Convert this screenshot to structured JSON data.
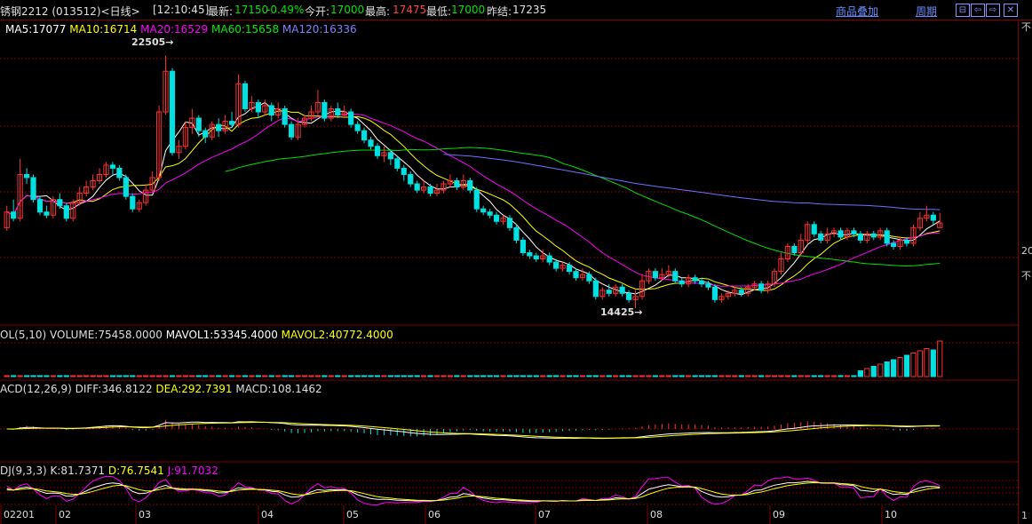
{
  "header": {
    "instrument": "锈钢2212 (013512)<日线>",
    "time": "[12:10:45]",
    "last_label": "最新:",
    "last_value": "17150",
    "change": "-0.49%",
    "open_label": "今开:",
    "open_value": "17000",
    "high_label": "最高:",
    "high_value": "17475",
    "low_label": "最低:",
    "low_value": "17000",
    "prev_label": "昨结:",
    "prev_value": "17235",
    "overlay_link": "商品叠加",
    "period_link": "周期"
  },
  "toolbar_icons": [
    "restore-icon",
    "back-icon",
    "forward-icon",
    "close-icon"
  ],
  "colors": {
    "up": "#ff3030",
    "down": "#00e0e0",
    "ma5": "#ffffff",
    "ma10": "#ffff00",
    "ma20": "#ff00ff",
    "ma60": "#00e000",
    "ma120": "#7070ff",
    "grid": "#800000"
  },
  "ma_legend": {
    "ma5": "MA5:17077",
    "ma10": "MA10:16714",
    "ma20": "MA20:16529",
    "ma60": "MA60:15658",
    "ma120": "MA120:16336"
  },
  "vol_legend": {
    "name": "OL(5,10)",
    "volume": "VOLUME:75458.0000",
    "mavol1": "MAVOL1:53345.4000",
    "mavol2": "MAVOL2:40772.4000"
  },
  "macd_legend": {
    "name": "ACD(12,26,9)",
    "diff": "DIFF:346.8122",
    "dea": "DEA:292.7391",
    "macd": "MACD:108.1462"
  },
  "kdj_legend": {
    "name": "DJ(9,3,3)",
    "k": "K:81.7371",
    "d": "D:76.7541",
    "j": "J:91.7032"
  },
  "right_panel": {
    "t1": "不",
    "t2": "20",
    "t3": "不",
    "t4": "1"
  },
  "chart_data": {
    "type": "candlestick",
    "price_annotations": {
      "high": "22505→",
      "low": "14425→"
    },
    "x_tick_labels": [
      "02201",
      "02",
      "03",
      "04",
      "05",
      "06",
      "07",
      "08",
      "09",
      "10"
    ],
    "price_range": [
      14000,
      23000
    ],
    "candles": [
      {
        "o": 17000,
        "c": 17500,
        "h": 17700,
        "l": 16900
      },
      {
        "o": 17500,
        "c": 17300,
        "h": 17900,
        "l": 17200
      },
      {
        "o": 17300,
        "c": 18700,
        "h": 19200,
        "l": 17200
      },
      {
        "o": 18700,
        "c": 18600,
        "h": 18900,
        "l": 18400
      },
      {
        "o": 18600,
        "c": 17900,
        "h": 18700,
        "l": 17800
      },
      {
        "o": 17900,
        "c": 17500,
        "h": 18000,
        "l": 17400
      },
      {
        "o": 17500,
        "c": 17400,
        "h": 17700,
        "l": 17300
      },
      {
        "o": 17400,
        "c": 17900,
        "h": 18000,
        "l": 17300
      },
      {
        "o": 17900,
        "c": 17700,
        "h": 18100,
        "l": 17600
      },
      {
        "o": 17700,
        "c": 17300,
        "h": 17800,
        "l": 17200
      },
      {
        "o": 17300,
        "c": 17800,
        "h": 17900,
        "l": 17200
      },
      {
        "o": 17800,
        "c": 18100,
        "h": 18300,
        "l": 17700
      },
      {
        "o": 18100,
        "c": 18300,
        "h": 18500,
        "l": 18000
      },
      {
        "o": 18300,
        "c": 18500,
        "h": 18700,
        "l": 18200
      },
      {
        "o": 18500,
        "c": 18700,
        "h": 18900,
        "l": 18400
      },
      {
        "o": 18700,
        "c": 19000,
        "h": 19100,
        "l": 18600
      },
      {
        "o": 19000,
        "c": 18900,
        "h": 19100,
        "l": 18700
      },
      {
        "o": 18900,
        "c": 18600,
        "h": 19000,
        "l": 18500
      },
      {
        "o": 18600,
        "c": 18000,
        "h": 18700,
        "l": 17900
      },
      {
        "o": 18000,
        "c": 17600,
        "h": 18100,
        "l": 17500
      },
      {
        "o": 17600,
        "c": 17800,
        "h": 17900,
        "l": 17500
      },
      {
        "o": 17800,
        "c": 18200,
        "h": 18400,
        "l": 17700
      },
      {
        "o": 18200,
        "c": 18600,
        "h": 18800,
        "l": 18100
      },
      {
        "o": 18600,
        "c": 20700,
        "h": 20900,
        "l": 18500
      },
      {
        "o": 20700,
        "c": 22000,
        "h": 22505,
        "l": 20600
      },
      {
        "o": 22000,
        "c": 19400,
        "h": 22100,
        "l": 19300
      },
      {
        "o": 19400,
        "c": 19600,
        "h": 19800,
        "l": 19200
      },
      {
        "o": 19600,
        "c": 20200,
        "h": 20400,
        "l": 19500
      },
      {
        "o": 20200,
        "c": 20500,
        "h": 20800,
        "l": 20000
      },
      {
        "o": 20500,
        "c": 20100,
        "h": 20600,
        "l": 19900
      },
      {
        "o": 20100,
        "c": 19900,
        "h": 20200,
        "l": 19700
      },
      {
        "o": 19900,
        "c": 20300,
        "h": 20400,
        "l": 19800
      },
      {
        "o": 20300,
        "c": 20100,
        "h": 20500,
        "l": 19900
      },
      {
        "o": 20100,
        "c": 20400,
        "h": 20600,
        "l": 20000
      },
      {
        "o": 20400,
        "c": 20300,
        "h": 20700,
        "l": 20200
      },
      {
        "o": 20300,
        "c": 21600,
        "h": 21900,
        "l": 20200
      },
      {
        "o": 21600,
        "c": 20800,
        "h": 21700,
        "l": 20700
      },
      {
        "o": 20800,
        "c": 21000,
        "h": 21200,
        "l": 20700
      },
      {
        "o": 21000,
        "c": 20700,
        "h": 21100,
        "l": 20500
      },
      {
        "o": 20700,
        "c": 20900,
        "h": 21100,
        "l": 20600
      },
      {
        "o": 20900,
        "c": 20600,
        "h": 21000,
        "l": 20400
      },
      {
        "o": 20600,
        "c": 20800,
        "h": 21000,
        "l": 20500
      },
      {
        "o": 20800,
        "c": 20300,
        "h": 20900,
        "l": 20200
      },
      {
        "o": 20300,
        "c": 19900,
        "h": 20400,
        "l": 19800
      },
      {
        "o": 19900,
        "c": 20300,
        "h": 20500,
        "l": 19800
      },
      {
        "o": 20300,
        "c": 20500,
        "h": 20600,
        "l": 20200
      },
      {
        "o": 20500,
        "c": 20700,
        "h": 20900,
        "l": 20400
      },
      {
        "o": 20700,
        "c": 21000,
        "h": 21400,
        "l": 20600
      },
      {
        "o": 21000,
        "c": 20500,
        "h": 21100,
        "l": 20400
      },
      {
        "o": 20500,
        "c": 20800,
        "h": 20900,
        "l": 20400
      },
      {
        "o": 20800,
        "c": 20600,
        "h": 21000,
        "l": 20500
      },
      {
        "o": 20600,
        "c": 20700,
        "h": 20900,
        "l": 20500
      },
      {
        "o": 20700,
        "c": 20300,
        "h": 20800,
        "l": 20200
      },
      {
        "o": 20300,
        "c": 20100,
        "h": 20400,
        "l": 20000
      },
      {
        "o": 20100,
        "c": 19800,
        "h": 20200,
        "l": 19700
      },
      {
        "o": 19800,
        "c": 19600,
        "h": 19900,
        "l": 19500
      },
      {
        "o": 19600,
        "c": 19300,
        "h": 19700,
        "l": 19200
      },
      {
        "o": 19300,
        "c": 19400,
        "h": 19600,
        "l": 19100
      },
      {
        "o": 19400,
        "c": 19200,
        "h": 19500,
        "l": 19000
      },
      {
        "o": 19200,
        "c": 18900,
        "h": 19300,
        "l": 18800
      },
      {
        "o": 18900,
        "c": 18700,
        "h": 19000,
        "l": 18500
      },
      {
        "o": 18700,
        "c": 18400,
        "h": 18800,
        "l": 18300
      },
      {
        "o": 18400,
        "c": 18200,
        "h": 18500,
        "l": 18100
      },
      {
        "o": 18200,
        "c": 18300,
        "h": 18500,
        "l": 18100
      },
      {
        "o": 18300,
        "c": 18100,
        "h": 18400,
        "l": 18000
      },
      {
        "o": 18100,
        "c": 18200,
        "h": 18400,
        "l": 18000
      },
      {
        "o": 18200,
        "c": 18400,
        "h": 18500,
        "l": 18100
      },
      {
        "o": 18400,
        "c": 18500,
        "h": 18700,
        "l": 18300
      },
      {
        "o": 18500,
        "c": 18300,
        "h": 18600,
        "l": 18200
      },
      {
        "o": 18300,
        "c": 18500,
        "h": 18700,
        "l": 18200
      },
      {
        "o": 18500,
        "c": 18200,
        "h": 18600,
        "l": 18100
      },
      {
        "o": 18200,
        "c": 17600,
        "h": 18300,
        "l": 17500
      },
      {
        "o": 17600,
        "c": 17500,
        "h": 17700,
        "l": 17400
      },
      {
        "o": 17500,
        "c": 17400,
        "h": 17600,
        "l": 17300
      },
      {
        "o": 17400,
        "c": 17200,
        "h": 17500,
        "l": 17100
      },
      {
        "o": 17200,
        "c": 17300,
        "h": 17400,
        "l": 17100
      },
      {
        "o": 17300,
        "c": 17000,
        "h": 17400,
        "l": 16900
      },
      {
        "o": 17000,
        "c": 16600,
        "h": 17100,
        "l": 16500
      },
      {
        "o": 16600,
        "c": 16200,
        "h": 16700,
        "l": 16100
      },
      {
        "o": 16200,
        "c": 16100,
        "h": 16300,
        "l": 16000
      },
      {
        "o": 16100,
        "c": 16000,
        "h": 16200,
        "l": 15900
      },
      {
        "o": 16000,
        "c": 16100,
        "h": 16300,
        "l": 15900
      },
      {
        "o": 16100,
        "c": 15900,
        "h": 16200,
        "l": 15800
      },
      {
        "o": 15900,
        "c": 15700,
        "h": 16000,
        "l": 15600
      },
      {
        "o": 15700,
        "c": 15800,
        "h": 15900,
        "l": 15600
      },
      {
        "o": 15800,
        "c": 15600,
        "h": 15900,
        "l": 15500
      },
      {
        "o": 15600,
        "c": 15400,
        "h": 15700,
        "l": 15300
      },
      {
        "o": 15400,
        "c": 15500,
        "h": 15700,
        "l": 15300
      },
      {
        "o": 15500,
        "c": 15300,
        "h": 15600,
        "l": 15200
      },
      {
        "o": 15300,
        "c": 14800,
        "h": 15400,
        "l": 14700
      },
      {
        "o": 14800,
        "c": 15000,
        "h": 15100,
        "l": 14700
      },
      {
        "o": 15000,
        "c": 14900,
        "h": 15200,
        "l": 14800
      },
      {
        "o": 14900,
        "c": 15100,
        "h": 15200,
        "l": 14800
      },
      {
        "o": 15100,
        "c": 14900,
        "h": 15200,
        "l": 14800
      },
      {
        "o": 14900,
        "c": 14700,
        "h": 15000,
        "l": 14600
      },
      {
        "o": 14700,
        "c": 14800,
        "h": 15000,
        "l": 14425
      },
      {
        "o": 14800,
        "c": 15300,
        "h": 15500,
        "l": 14700
      },
      {
        "o": 15300,
        "c": 15600,
        "h": 15700,
        "l": 15200
      },
      {
        "o": 15600,
        "c": 15400,
        "h": 15700,
        "l": 15300
      },
      {
        "o": 15400,
        "c": 15500,
        "h": 15700,
        "l": 15300
      },
      {
        "o": 15500,
        "c": 15600,
        "h": 15800,
        "l": 15400
      },
      {
        "o": 15600,
        "c": 15300,
        "h": 15700,
        "l": 15200
      },
      {
        "o": 15300,
        "c": 15200,
        "h": 15400,
        "l": 15100
      },
      {
        "o": 15200,
        "c": 15400,
        "h": 15500,
        "l": 15100
      },
      {
        "o": 15400,
        "c": 15300,
        "h": 15500,
        "l": 15200
      },
      {
        "o": 15300,
        "c": 15200,
        "h": 15400,
        "l": 15100
      },
      {
        "o": 15200,
        "c": 15100,
        "h": 15300,
        "l": 15000
      },
      {
        "o": 15100,
        "c": 14700,
        "h": 15200,
        "l": 14600
      },
      {
        "o": 14700,
        "c": 14800,
        "h": 14900,
        "l": 14600
      },
      {
        "o": 14800,
        "c": 14900,
        "h": 15000,
        "l": 14700
      },
      {
        "o": 14900,
        "c": 15000,
        "h": 15100,
        "l": 14800
      },
      {
        "o": 15000,
        "c": 14900,
        "h": 15100,
        "l": 14800
      },
      {
        "o": 14900,
        "c": 15100,
        "h": 15200,
        "l": 14800
      },
      {
        "o": 15100,
        "c": 15200,
        "h": 15300,
        "l": 15000
      },
      {
        "o": 15200,
        "c": 15000,
        "h": 15300,
        "l": 14900
      },
      {
        "o": 15000,
        "c": 15200,
        "h": 15300,
        "l": 14900
      },
      {
        "o": 15200,
        "c": 15600,
        "h": 15700,
        "l": 15100
      },
      {
        "o": 15600,
        "c": 16000,
        "h": 16200,
        "l": 15500
      },
      {
        "o": 16000,
        "c": 16400,
        "h": 16500,
        "l": 15900
      },
      {
        "o": 16400,
        "c": 16200,
        "h": 16500,
        "l": 16100
      },
      {
        "o": 16200,
        "c": 16600,
        "h": 16800,
        "l": 16100
      },
      {
        "o": 16600,
        "c": 17100,
        "h": 17200,
        "l": 16500
      },
      {
        "o": 17100,
        "c": 16800,
        "h": 17200,
        "l": 16700
      },
      {
        "o": 16800,
        "c": 16600,
        "h": 16900,
        "l": 16500
      },
      {
        "o": 16600,
        "c": 16800,
        "h": 17000,
        "l": 16500
      },
      {
        "o": 16800,
        "c": 16900,
        "h": 17000,
        "l": 16700
      },
      {
        "o": 16900,
        "c": 16700,
        "h": 17000,
        "l": 16600
      },
      {
        "o": 16700,
        "c": 16900,
        "h": 17000,
        "l": 16600
      },
      {
        "o": 16900,
        "c": 16800,
        "h": 17000,
        "l": 16700
      },
      {
        "o": 16800,
        "c": 16600,
        "h": 16900,
        "l": 16500
      },
      {
        "o": 16600,
        "c": 16800,
        "h": 16900,
        "l": 16500
      },
      {
        "o": 16800,
        "c": 16700,
        "h": 16900,
        "l": 16600
      },
      {
        "o": 16700,
        "c": 16900,
        "h": 17000,
        "l": 16600
      },
      {
        "o": 16900,
        "c": 16500,
        "h": 17000,
        "l": 16400
      },
      {
        "o": 16500,
        "c": 16400,
        "h": 16600,
        "l": 16300
      },
      {
        "o": 16400,
        "c": 16600,
        "h": 16700,
        "l": 16300
      },
      {
        "o": 16600,
        "c": 16500,
        "h": 16700,
        "l": 16400
      },
      {
        "o": 16500,
        "c": 17000,
        "h": 17100,
        "l": 16400
      },
      {
        "o": 17000,
        "c": 17300,
        "h": 17500,
        "l": 16900
      },
      {
        "o": 17300,
        "c": 17400,
        "h": 17700,
        "l": 17200
      },
      {
        "o": 17400,
        "c": 17235,
        "h": 17500,
        "l": 17100
      },
      {
        "o": 17000,
        "c": 17150,
        "h": 17475,
        "l": 17000
      }
    ],
    "ma_series": [
      {
        "name": "MA5",
        "color": "#ffffff"
      },
      {
        "name": "MA10",
        "color": "#ffff00"
      },
      {
        "name": "MA20",
        "color": "#ff00ff"
      },
      {
        "name": "MA60",
        "color": "#00e000"
      },
      {
        "name": "MA120",
        "color": "#7070ff"
      }
    ]
  }
}
